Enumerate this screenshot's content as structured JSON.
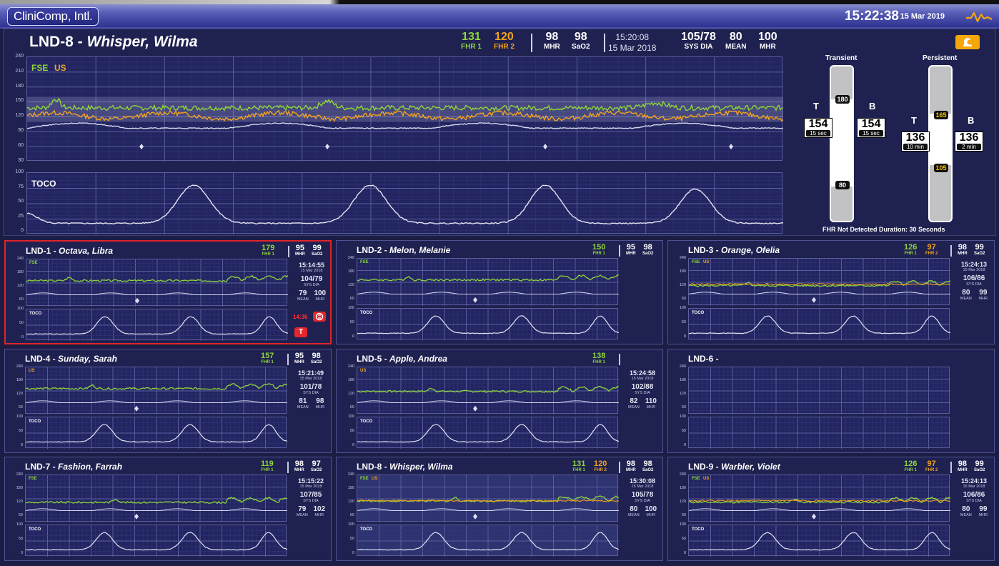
{
  "app": {
    "logo": "CliniComp, Intl.",
    "clock": "15:22:38",
    "date": "15 Mar 2019"
  },
  "colors": {
    "fhr1": "#8fd63a",
    "fhr2": "#f2a31d",
    "maternal": "#d8d9ec",
    "alert": "#e0242b",
    "bell": "#f5a70a",
    "background": "#1f2150"
  },
  "main": {
    "bed": "LND-8",
    "dash": " - ",
    "patient": "Whisper, Wilma",
    "fhr1": {
      "value": "131",
      "label": "FHR 1"
    },
    "fhr2": {
      "value": "120",
      "label": "FHR 2"
    },
    "mhr": {
      "value": "98",
      "label": "MHR"
    },
    "sao2": {
      "value": "98",
      "label": "SaO2"
    },
    "time": "15:20:08",
    "date": "15 Mar 2018",
    "bp": {
      "value": "105/78",
      "label": "SYS DIA"
    },
    "mean": {
      "value": "80",
      "label": "MEAN"
    },
    "mhr2": {
      "value": "100",
      "label": "MHR"
    },
    "fhr_strip": {
      "labels": {
        "fse": "FSE",
        "us": "US"
      },
      "y_ticks": [
        "240",
        "210",
        "180",
        "150",
        "120",
        "90",
        "60",
        "30"
      ],
      "y_range": [
        30,
        240
      ],
      "normal_band": [
        110,
        160
      ]
    },
    "toco_strip": {
      "label": "TOCO",
      "y_ticks": [
        "100",
        "75",
        "50",
        "25",
        "0"
      ],
      "y_range": [
        0,
        100
      ]
    },
    "thresholds": {
      "transient": {
        "title": "Transient",
        "upper": "180",
        "lower": "80",
        "t_label": "T",
        "b_label": "B",
        "t_value": "154",
        "t_duration": "15 sec",
        "b_value": "154",
        "b_duration": "15 sec"
      },
      "persistent": {
        "title": "Persistent",
        "upper": "165",
        "lower": "105",
        "t_label": "T",
        "b_label": "B",
        "t_value": "136",
        "t_duration": "10 min",
        "b_value": "136",
        "b_duration": "2 min"
      },
      "not_detected": "FHR Not Detected Duration: 30 Seconds"
    }
  },
  "tiles": [
    {
      "bed": "LND-1",
      "patient": "Octava, Libra",
      "fhr1": "179",
      "fhr1_label": "FHR 1",
      "fhr2": null,
      "fhr2_label": null,
      "mhr": "95",
      "sao2": "99",
      "time": "15:14:55",
      "date": "15 Mar 2018",
      "bp": "104/79",
      "bp_label": "SYS DIA",
      "mean": "79",
      "mhr2": "100",
      "labels": [
        "FSE"
      ],
      "alert": true,
      "alert_time": "14:36",
      "alert_btn": "T"
    },
    {
      "bed": "LND-2",
      "patient": "Melon, Melanie",
      "fhr1": "150",
      "fhr1_label": "FHR 1",
      "fhr2": null,
      "fhr2_label": null,
      "mhr": "95",
      "sao2": "98",
      "time": null,
      "date": null,
      "bp": null,
      "bp_label": null,
      "mean": null,
      "mhr2": null,
      "labels": [
        "FSE"
      ],
      "alert": false
    },
    {
      "bed": "LND-3",
      "patient": "Orange, Ofelia",
      "fhr1": "126",
      "fhr1_label": "FHR 1",
      "fhr2": "97",
      "fhr2_label": "FHR 2",
      "mhr": "98",
      "sao2": "99",
      "time": "15:24:13",
      "date": "15 Mar 2018",
      "bp": "106/86",
      "bp_label": "SYS DIA",
      "mean": "80",
      "mhr2": "99",
      "labels": [
        "FSE",
        "US"
      ],
      "alert": false
    },
    {
      "bed": "LND-4",
      "patient": "Sunday, Sarah",
      "fhr1": "157",
      "fhr1_label": "FHR 1",
      "fhr2": null,
      "fhr2_label": null,
      "mhr": "95",
      "sao2": "98",
      "time": "15:21:49",
      "date": "15 Mar 2018",
      "bp": "101/78",
      "bp_label": "SYS DIA",
      "mean": "81",
      "mhr2": "98",
      "labels": [
        "US"
      ],
      "alert": false
    },
    {
      "bed": "LND-5",
      "patient": "Apple, Andrea",
      "fhr1": "138",
      "fhr1_label": "FHR 1",
      "fhr2": null,
      "fhr2_label": null,
      "mhr": null,
      "sao2": null,
      "time": "15:24:58",
      "date": "15 Mar 2018",
      "bp": "102/88",
      "bp_label": "SYS DIA",
      "mean": "82",
      "mhr2": "110",
      "labels": [
        "US"
      ],
      "alert": false
    },
    {
      "bed": "LND-6",
      "patient": "",
      "fhr1": null,
      "fhr1_label": null,
      "fhr2": null,
      "fhr2_label": null,
      "mhr": null,
      "sao2": null,
      "time": null,
      "date": null,
      "bp": null,
      "bp_label": null,
      "mean": null,
      "mhr2": null,
      "labels": [],
      "alert": false,
      "empty": true
    },
    {
      "bed": "LND-7",
      "patient": "Fashion, Farrah",
      "fhr1": "119",
      "fhr1_label": "FHR 1",
      "fhr2": null,
      "fhr2_label": null,
      "mhr": "98",
      "sao2": "97",
      "time": "15:15:22",
      "date": "15 Mar 2018",
      "bp": "107/85",
      "bp_label": "SYS DIA",
      "mean": "79",
      "mhr2": "102",
      "labels": [
        "FSE"
      ],
      "alert": false
    },
    {
      "bed": "LND-8",
      "patient": "Whisper, Wilma",
      "fhr1": "131",
      "fhr1_label": "FHR 1",
      "fhr2": "120",
      "fhr2_label": "FHR 2",
      "mhr": "98",
      "sao2": "98",
      "time": "15:30:08",
      "date": "15 Mar 2018",
      "bp": "105/78",
      "bp_label": "SYS DIA",
      "mean": "80",
      "mhr2": "100",
      "labels": [
        "FSE",
        "US"
      ],
      "alert": false,
      "selected": true
    },
    {
      "bed": "LND-9",
      "patient": "Warbler, Violet",
      "fhr1": "126",
      "fhr1_label": "FHR 1",
      "fhr2": "97",
      "fhr2_label": "FHR 2",
      "mhr": "98",
      "sao2": "99",
      "time": "15:24:13",
      "date": "15 Mar 2018",
      "bp": "106/86",
      "bp_label": "SYS DIA",
      "mean": "80",
      "mhr2": "99",
      "labels": [
        "FSE",
        "US"
      ],
      "alert": false
    }
  ],
  "tile_labels": {
    "mhr": "MHR",
    "sao2": "SaO2",
    "mean": "MEAN",
    "mhr2": "MHR",
    "toco": "TOCO",
    "fhr_ticks": [
      "240",
      "180",
      "120",
      "60"
    ],
    "toco_ticks": [
      "100",
      "50",
      "0"
    ]
  }
}
